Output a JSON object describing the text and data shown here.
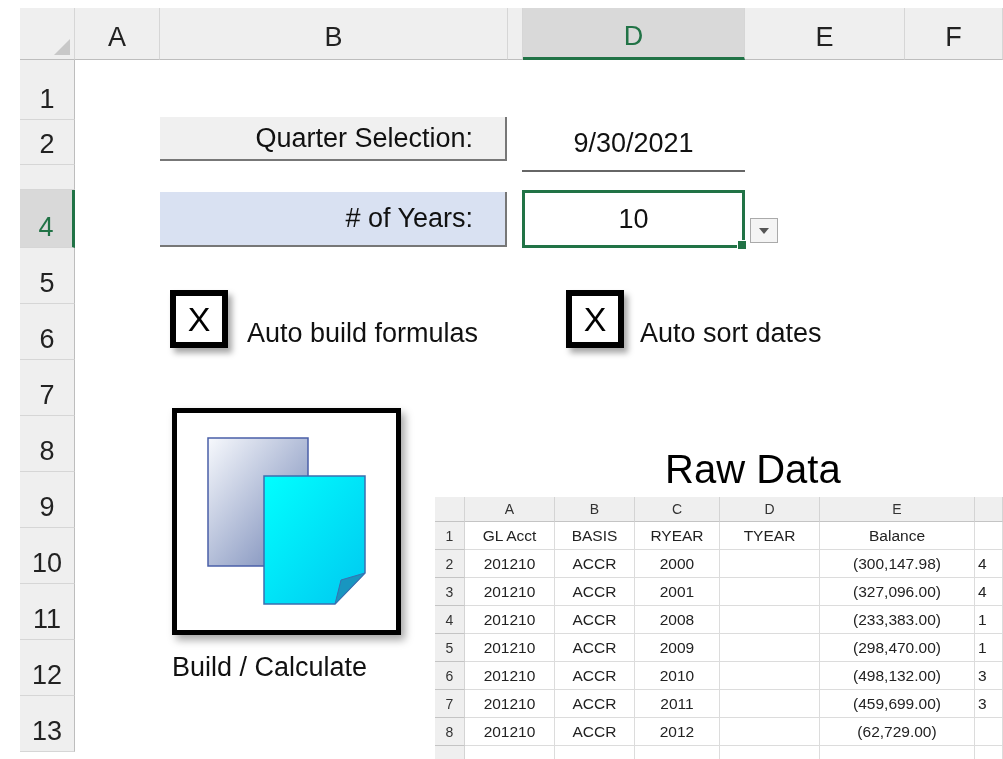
{
  "sheet": {
    "columns": [
      {
        "label": "A",
        "selected": false
      },
      {
        "label": "B",
        "selected": false
      },
      {
        "selected": false
      },
      {
        "label": "D",
        "selected": true
      },
      {
        "label": "E",
        "selected": false
      },
      {
        "label": "F",
        "selected": false
      }
    ],
    "rows": [
      {
        "label": "1",
        "selected": false
      },
      {
        "label": "2",
        "selected": false
      },
      {
        "selected": false
      },
      {
        "label": "4",
        "selected": true
      },
      {
        "label": "5",
        "selected": false
      },
      {
        "label": "6",
        "selected": false
      },
      {
        "label": "7",
        "selected": false
      },
      {
        "label": "8",
        "selected": false
      },
      {
        "label": "9",
        "selected": false
      },
      {
        "label": "10",
        "selected": false
      },
      {
        "label": "11",
        "selected": false
      },
      {
        "label": "12",
        "selected": false
      },
      {
        "label": "13",
        "selected": false
      }
    ]
  },
  "quarter": {
    "label": "Quarter Selection:",
    "value": "9/30/2021"
  },
  "years": {
    "label": "# of Years:",
    "value": "10",
    "selected": true
  },
  "checkboxes": [
    {
      "label": "Auto build formulas",
      "checked": true,
      "mark": "X"
    },
    {
      "label": "Auto sort dates",
      "checked": true,
      "mark": "X"
    }
  ],
  "build_button": {
    "label": "Build / Calculate"
  },
  "raw_data": {
    "title": "Raw Data",
    "columns": [
      "A",
      "B",
      "C",
      "D",
      "E"
    ],
    "rows": [
      {
        "num": "1",
        "kind": "header",
        "a": "GL Acct",
        "b": "BASIS",
        "c": "RYEAR",
        "d": "TYEAR",
        "e": "Balance"
      },
      {
        "num": "2",
        "kind": "data",
        "a": "201210",
        "b": "ACCR",
        "c": "2000",
        "e": "(300,147.98)",
        "f": "4"
      },
      {
        "num": "3",
        "kind": "data",
        "a": "201210",
        "b": "ACCR",
        "c": "2001",
        "e": "(327,096.00)",
        "f": "4"
      },
      {
        "num": "4",
        "kind": "data",
        "a": "201210",
        "b": "ACCR",
        "c": "2008",
        "e": "(233,383.00)",
        "f": "1"
      },
      {
        "num": "5",
        "kind": "data",
        "a": "201210",
        "b": "ACCR",
        "c": "2009",
        "e": "(298,470.00)",
        "f": "1"
      },
      {
        "num": "6",
        "kind": "data",
        "a": "201210",
        "b": "ACCR",
        "c": "2010",
        "e": "(498,132.00)",
        "f": "3"
      },
      {
        "num": "7",
        "kind": "data",
        "a": "201210",
        "b": "ACCR",
        "c": "2011",
        "e": "(459,699.00)",
        "f": "3"
      },
      {
        "num": "8",
        "kind": "data",
        "a": "201210",
        "b": "ACCR",
        "c": "2012",
        "e": "(62,729.00)"
      },
      {
        "kind": "data"
      }
    ]
  }
}
